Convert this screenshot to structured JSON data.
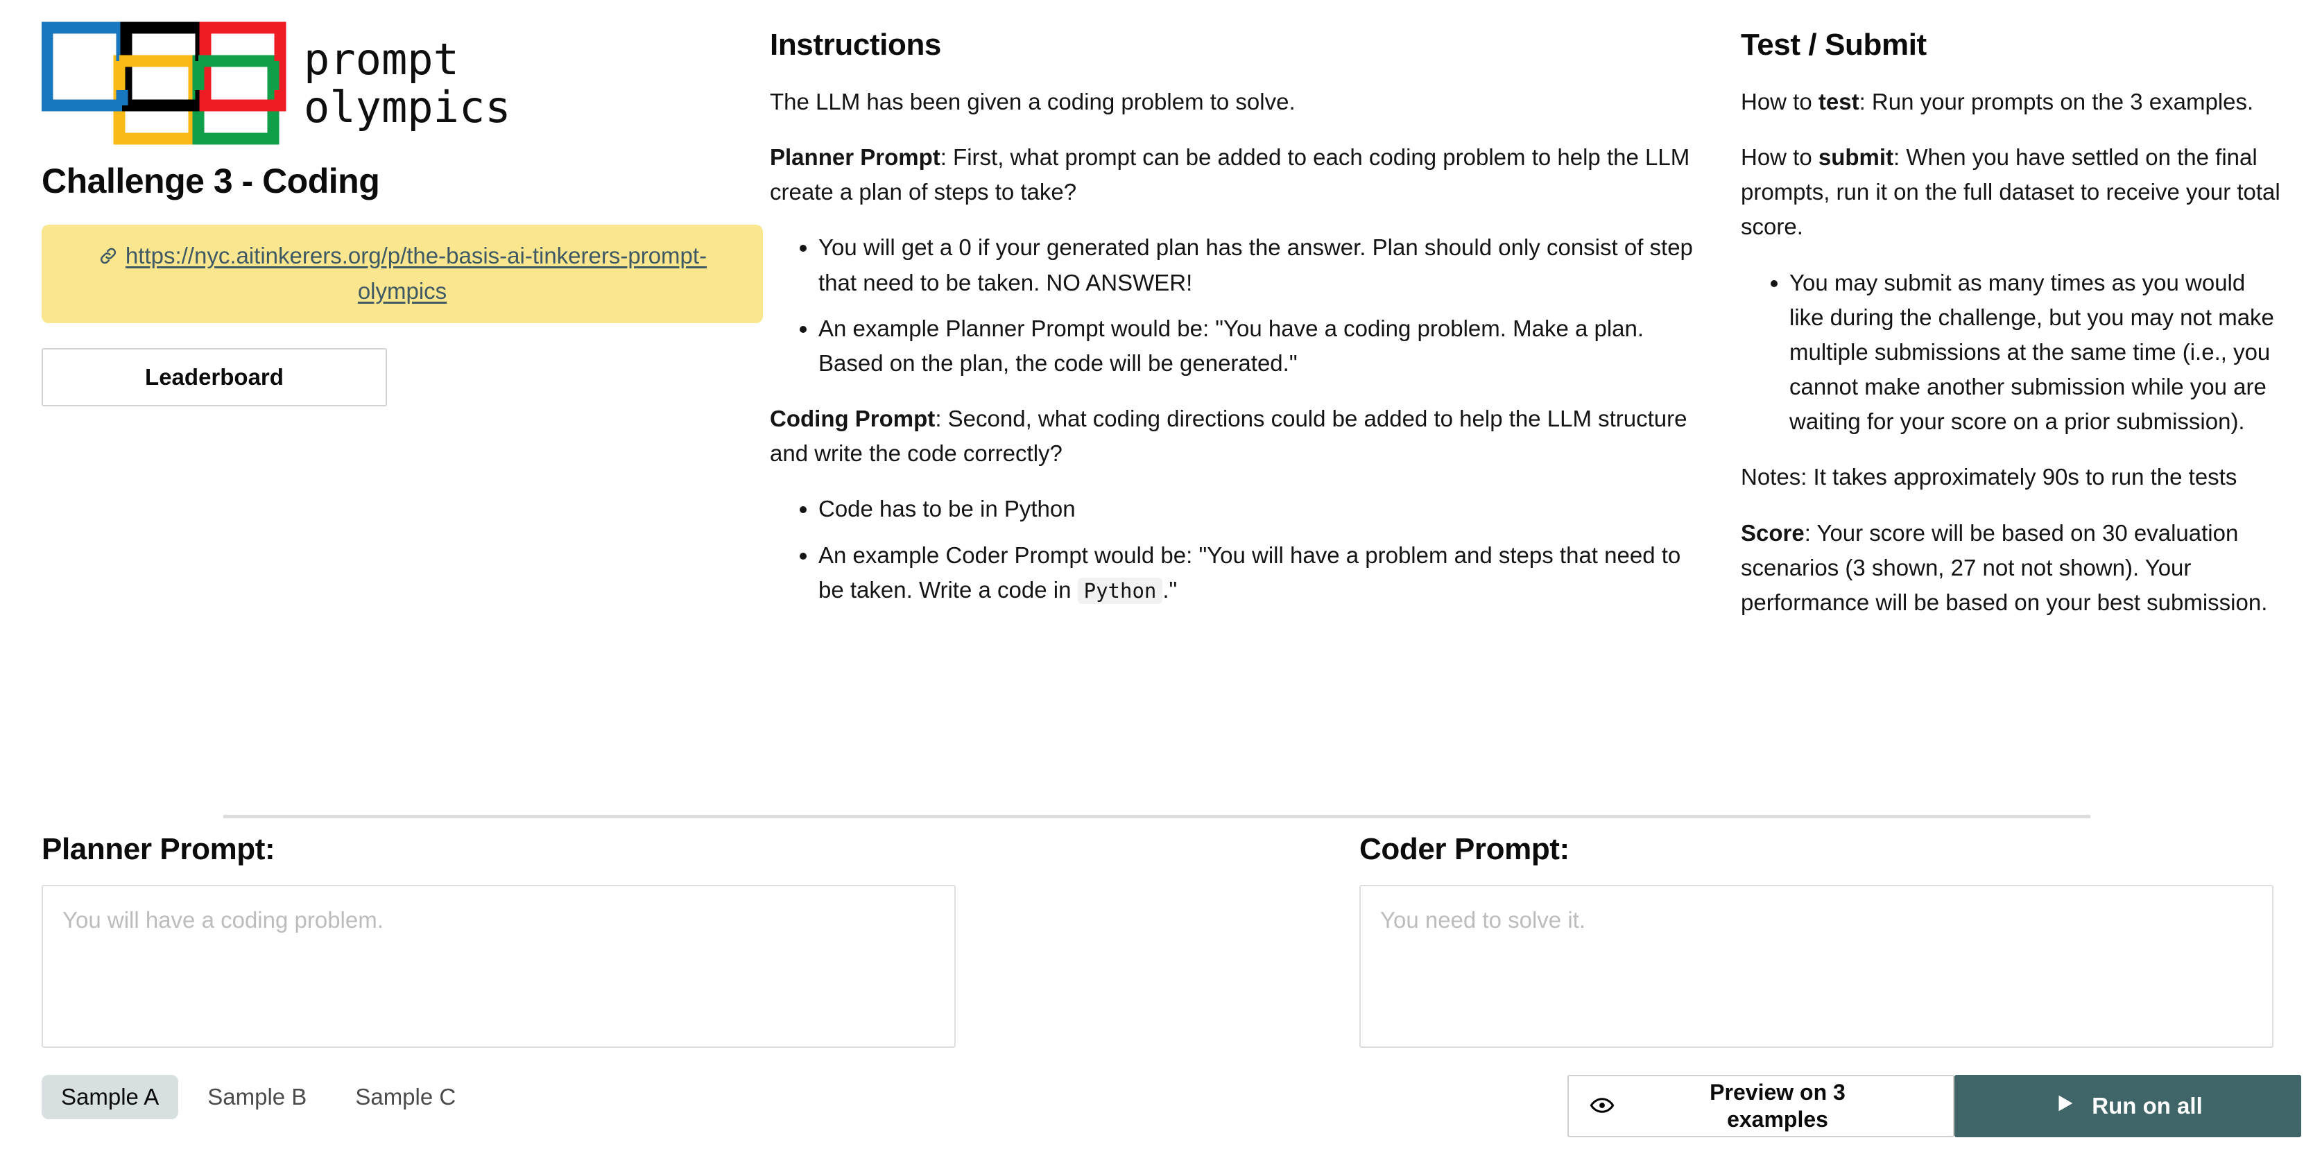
{
  "brand": {
    "logo_icon": "olympic-squares-logo",
    "name_line1": "prompt",
    "name_line2": "olympics",
    "ring_colors": [
      "#1878bf",
      "#000000",
      "#ee1d23",
      "#f9b916",
      "#109e49"
    ]
  },
  "sidebar": {
    "challenge_title": "Challenge 3 - Coding",
    "link_icon": "link-icon",
    "link_text": "https://nyc.aitinkerers.org/p/the-basis-ai-tinkerers-prompt-olympics",
    "link_bg": "#fae68f",
    "leaderboard_label": "Leaderboard"
  },
  "instructions": {
    "heading": "Instructions",
    "intro": "The LLM has been given a coding problem to solve.",
    "planner_label": "Planner Prompt",
    "planner_text": ": First, what prompt can be added to each coding problem to help the LLM create a plan of steps to take?",
    "planner_bullets": [
      "You will get a 0 if your generated plan has the answer. Plan should only consist of step that need to be taken. NO ANSWER!",
      "An example Planner Prompt would be: \"You have a coding problem. Make a plan. Based on the plan, the code will be generated.\""
    ],
    "coding_label": "Coding Prompt",
    "coding_text": ": Second, what coding directions could be added to help the LLM structure and write the code correctly?",
    "coding_bullet_1": "Code has to be in Python",
    "coding_bullet_2_pre": "An example Coder Prompt would be: \"You will have a problem and steps that need to be taken. Write a code in ",
    "coding_bullet_2_code": "Python",
    "coding_bullet_2_post": ".\""
  },
  "test_submit": {
    "heading": "Test / Submit",
    "how_to_test_label": "test",
    "how_to_test_prefix": "How to ",
    "how_to_test_text": ": Run your prompts on the 3 examples.",
    "how_to_submit_prefix": "How to ",
    "how_to_submit_label": "submit",
    "how_to_submit_text": ": When you have settled on the final prompts, run it on the full dataset to receive your total score.",
    "submit_bullets": [
      "You may submit as many times as you would like during the challenge, but you may not make multiple submissions at the same time (i.e., you cannot make another submission while you are waiting for your score on a prior submission)."
    ],
    "notes": "Notes: It takes approximately 90s to run the tests",
    "score_label": "Score",
    "score_text": ": Your score will be based on 30 evaluation scenarios (3 shown, 27 not not shown). Your performance will be based on your best submission."
  },
  "planner_panel": {
    "label": "Planner Prompt:",
    "textarea_value": "",
    "textarea_placeholder": "You will have a coding problem.",
    "tabs": [
      {
        "label": "Sample A",
        "active": true
      },
      {
        "label": "Sample B",
        "active": false
      },
      {
        "label": "Sample C",
        "active": false
      }
    ]
  },
  "coder_panel": {
    "label": "Coder Prompt:",
    "textarea_value": "",
    "textarea_placeholder": "You need to solve it.",
    "preview_icon": "eye-icon",
    "preview_label_line1": "Preview on 3",
    "preview_label_line2": "examples",
    "run_icon": "play-icon",
    "run_label": "Run on all",
    "run_bg": "#3f6569"
  }
}
